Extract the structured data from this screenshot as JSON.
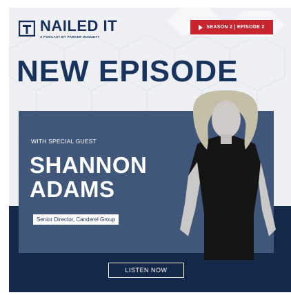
{
  "brand": {
    "name": "NAILED IT",
    "tagline": "A PODCAST BY PARKER HUGGETT",
    "logo_icon": "podcast-mark-icon"
  },
  "badge": {
    "icon": "play-icon",
    "text": "SEASON 2 | EPISODE 2"
  },
  "headline": "NEW EPISODE",
  "guest": {
    "label": "WITH SPECIAL GUEST",
    "first_name": "SHANNON",
    "last_name": "ADAMS",
    "title": "Senior Director, Canderel Group"
  },
  "cta": {
    "label": "LISTEN NOW"
  },
  "colors": {
    "navy": "#14294a",
    "panel": "#40577a",
    "accent_red": "#c8262f",
    "background": "#eef0f3"
  }
}
